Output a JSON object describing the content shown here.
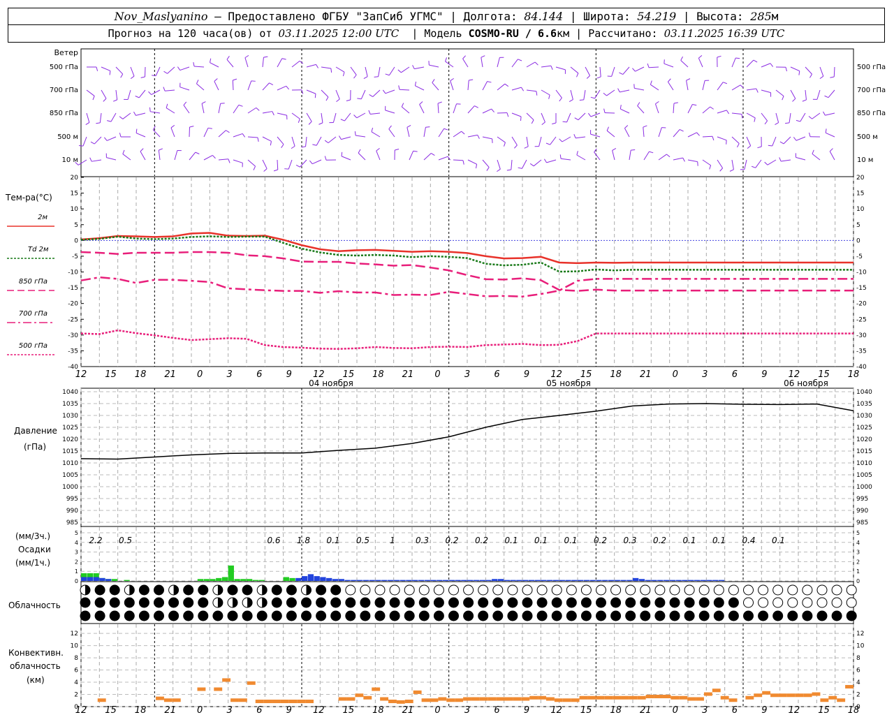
{
  "header": {
    "station": "Nov_Maslyanino",
    "provider": "— Предоставлено ФГБУ \"ЗапСиб УГМС\"",
    "lon_label": "| Долгота:",
    "lon": "84.144",
    "lat_label": "| Широта:",
    "lat": "54.219",
    "alt_label": "| Высота:",
    "alt": "285",
    "alt_unit": "м",
    "forecast_label": "Прогноз на 120 часа(ов) от",
    "forecast_from": "03.11.2025 12:00 UTC",
    "model_label": "| Модель",
    "model": "COSMO-RU / 6.6",
    "model_unit": "км",
    "calc_label": "| Рассчитано:",
    "calc_time": "03.11.2025 16:39 UTC"
  },
  "time_axis": {
    "hour_ticks": [
      "12",
      "15",
      "18",
      "21",
      "0",
      "3",
      "6",
      "9",
      "12",
      "15",
      "18",
      "21",
      "0",
      "3",
      "6",
      "9",
      "12",
      "15",
      "18",
      "21",
      "0",
      "3",
      "6",
      "9",
      "12",
      "15",
      "18"
    ],
    "dates": [
      "04 ноября",
      "05 ноября",
      "06 ноября"
    ]
  },
  "colors": {
    "wind": "#8a2be2",
    "t2m": "#e8322a",
    "td2m": "#1a7a1a",
    "t850": "#e81e7a",
    "t700": "#e81e7a",
    "t500": "#e81e7a",
    "pressure": "#000000",
    "precip_rain": "#22cc22",
    "precip_snow": "#2244dd",
    "conv": "#f08a30",
    "zero_line": "#4040e0"
  },
  "wind_panel": {
    "title": "Ветер",
    "levels": [
      "500 гПа",
      "700 гПа",
      "850 гПа",
      "500 м",
      "10 м"
    ]
  },
  "temp_panel": {
    "title": "Тем-ра(°C)",
    "legend": [
      "2м",
      "Td 2м",
      "850 гПа",
      "700 гПа",
      "500 гПа"
    ],
    "ticks": [
      "20",
      "15",
      "10",
      "5",
      "0",
      "-5",
      "-10",
      "-15",
      "-20",
      "-25",
      "-30",
      "-35",
      "-40"
    ]
  },
  "pressure_panel": {
    "title1": "Давление",
    "title2": "(гПа)",
    "ticks": [
      "1040",
      "1035",
      "1030",
      "1025",
      "1020",
      "1015",
      "1010",
      "1005",
      "1000",
      "995",
      "990",
      "985"
    ]
  },
  "precip_panel": {
    "unit3": "(мм/3ч.)",
    "title": "Осадки",
    "unit1": "(мм/1ч.)",
    "ticks": [
      "5",
      "4",
      "3",
      "2",
      "1",
      "0"
    ],
    "labels3h": [
      "2.2",
      "0.5",
      "",
      "",
      "",
      "",
      "0.6",
      "1.8",
      "0.1",
      "0.5",
      "1",
      "0.3",
      "0.2",
      "0.2",
      "0.1",
      "0.1",
      "0.1",
      "0.2",
      "0.3",
      "0.2",
      "0.1",
      "0.1",
      "0.4",
      "0.1",
      "",
      ""
    ]
  },
  "cloud_panel": {
    "title": "Облачность"
  },
  "conv_panel": {
    "title1": "Конвективн.",
    "title2": "облачность",
    "title3": "(км)",
    "ticks": [
      "12",
      "10",
      "8",
      "6",
      "4",
      "2",
      "0"
    ]
  },
  "chart_data": [
    {
      "type": "line",
      "title": "Тем-ра(°C)",
      "x_hours_from_start": [
        0,
        3,
        6,
        9,
        12,
        15,
        18,
        21,
        24,
        27,
        30,
        33,
        36,
        39,
        42,
        45,
        48,
        51,
        54,
        57,
        60,
        63,
        66,
        69,
        72,
        75,
        78,
        81,
        84,
        87,
        90,
        93,
        96,
        99,
        102,
        105,
        108,
        111,
        114,
        117,
        120,
        123,
        126,
        129,
        132,
        135,
        138,
        141,
        144,
        147,
        150
      ],
      "ylim": [
        -40,
        20
      ],
      "series": [
        {
          "name": "2м",
          "values": [
            0.3,
            0.7,
            1.4,
            1.3,
            1.1,
            1.3,
            2.2,
            2.4,
            1.5,
            1.4,
            1.5,
            0.2,
            -1.5,
            -2.8,
            -3.4,
            -3.1,
            -3.0,
            -3.3,
            -3.6,
            -3.4,
            -3.6,
            -4.0,
            -5.0,
            -5.7,
            -5.6,
            -5.2,
            -7.0,
            -7.2,
            -7.0,
            -7.1,
            -7.0,
            -7.0,
            -7.0,
            -7.0,
            -7.0,
            -7.0,
            -7.0,
            -7.0,
            -7.0,
            -7.0,
            -7.0,
            -7.0,
            -7.0,
            -7.0,
            -7.0,
            -7.0,
            -7.0,
            -7.0,
            -7.0,
            -7.0,
            -7.0
          ]
        },
        {
          "name": "Td 2м",
          "values": [
            0.2,
            0.5,
            1.2,
            0.6,
            0.4,
            0.6,
            1.1,
            1.3,
            1.1,
            1.2,
            1.2,
            -0.8,
            -2.6,
            -3.8,
            -4.6,
            -4.8,
            -4.6,
            -4.8,
            -5.3,
            -5.0,
            -5.2,
            -5.6,
            -7.4,
            -7.9,
            -7.7,
            -7.0,
            -9.9,
            -9.8,
            -9.2,
            -9.5,
            -9.3,
            -9.3,
            -9.3,
            -9.3,
            -9.3,
            -9.3,
            -9.3,
            -9.3,
            -9.3,
            -9.3,
            -9.3,
            -9.3,
            -9.3,
            -9.3,
            -9.3,
            -9.3,
            -9.3,
            -9.3,
            -9.3,
            -9.3,
            -9.3
          ]
        },
        {
          "name": "850 гПа",
          "values": [
            -3.7,
            -3.9,
            -4.3,
            -3.9,
            -3.9,
            -3.9,
            -3.7,
            -3.7,
            -3.9,
            -4.7,
            -5.0,
            -5.7,
            -6.7,
            -6.8,
            -6.8,
            -7.3,
            -7.6,
            -8.0,
            -7.8,
            -8.6,
            -9.5,
            -11.0,
            -12.3,
            -12.4,
            -12.0,
            -12.6,
            -15.7,
            -16.0,
            -15.6,
            -15.9,
            -15.9,
            -15.9,
            -15.9,
            -15.9,
            -15.9,
            -15.9,
            -15.9,
            -15.9,
            -15.9,
            -15.9,
            -15.9,
            -15.9,
            -15.9,
            -15.9,
            -15.9,
            -15.9,
            -15.9,
            -15.9,
            -15.9,
            -15.9,
            -15.9
          ]
        },
        {
          "name": "700 гПа",
          "values": [
            -12.7,
            -11.7,
            -12.2,
            -13.5,
            -12.5,
            -12.5,
            -12.8,
            -13.2,
            -15.2,
            -15.5,
            -15.8,
            -16.0,
            -16.0,
            -16.6,
            -16.1,
            -16.5,
            -16.5,
            -17.3,
            -17.2,
            -17.3,
            -16.3,
            -17.0,
            -17.7,
            -17.6,
            -17.8,
            -17.0,
            -15.9,
            -12.8,
            -12.2,
            -12.2,
            -12.2,
            -12.2,
            -12.2,
            -12.2,
            -12.2,
            -12.2,
            -12.2,
            -12.2,
            -12.2,
            -12.2,
            -12.2,
            -12.2,
            -12.2,
            -12.2,
            -12.2,
            -12.2,
            -12.2,
            -12.2,
            -12.2,
            -12.2,
            -12.2
          ]
        },
        {
          "name": "500 гПа",
          "values": [
            -29.5,
            -29.7,
            -28.5,
            -29.4,
            -30.1,
            -30.9,
            -31.6,
            -31.3,
            -31.0,
            -31.2,
            -33.2,
            -33.8,
            -34.0,
            -34.3,
            -34.4,
            -34.2,
            -33.8,
            -34.1,
            -34.2,
            -33.8,
            -33.7,
            -33.8,
            -33.2,
            -33.0,
            -32.8,
            -33.2,
            -33.1,
            -31.9,
            -29.5,
            -29.5,
            -29.5,
            -29.5,
            -29.5,
            -29.5,
            -29.5,
            -29.5,
            -29.5,
            -29.5,
            -29.5,
            -29.5,
            -29.5,
            -29.5,
            -29.5,
            -29.5,
            -29.5,
            -29.5,
            -29.5,
            -29.5,
            -29.5,
            -29.5,
            -29.5
          ]
        }
      ]
    },
    {
      "type": "line",
      "title": "Давление (гПа)",
      "x_hours_from_start": [
        0,
        6,
        12,
        18,
        24,
        30,
        36,
        42,
        48,
        54,
        60,
        66,
        72,
        78,
        84,
        90,
        96,
        102,
        108,
        114,
        120,
        126
      ],
      "ylim": [
        985,
        1040
      ],
      "series": [
        {
          "name": "Давление",
          "values": [
            1011.8,
            1011.6,
            1012.5,
            1013.4,
            1014.0,
            1014.2,
            1014.2,
            1015.3,
            1016.2,
            1018.2,
            1021.0,
            1025.0,
            1028.3,
            1030.0,
            1031.8,
            1034.0,
            1034.8,
            1035.0,
            1034.7,
            1034.6,
            1034.8,
            1032.0
          ]
        }
      ]
    },
    {
      "type": "bar",
      "title": "Осадки",
      "ylim": [
        0,
        5
      ],
      "series": [
        {
          "name": "rain",
          "values": [
            0.8,
            0.8,
            0.8,
            0.3,
            0.2,
            0.2,
            0.0,
            0.1,
            0.0,
            0.0,
            0.0,
            0.0,
            0.0,
            0.0,
            0.0,
            0.0,
            0.0,
            0.0,
            0.0,
            0.2,
            0.2,
            0.2,
            0.3,
            0.4,
            1.6,
            0.2,
            0.2,
            0.2,
            0.1,
            0.1,
            0.0,
            0.0,
            0.0,
            0.4,
            0.3
          ]
        },
        {
          "name": "snow",
          "values": [
            0.4,
            0.4,
            0.4,
            0.3,
            0.2,
            0.0,
            0.0,
            0.0,
            0.0,
            0.0,
            0.0,
            0.0,
            0.0,
            0.0,
            0.0,
            0.0,
            0.0,
            0.0,
            0.0,
            0.0,
            0.0,
            0.0,
            0.0,
            0.0,
            0.0,
            0.0,
            0.0,
            0.0,
            0.0,
            0.0,
            0.0,
            0.0,
            0.0,
            0.0,
            0.0,
            0.3,
            0.5,
            0.7,
            0.5,
            0.4,
            0.3,
            0.2,
            0.2,
            0.1,
            0.1,
            0.1,
            0.1,
            0.1,
            0.1,
            0.1,
            0.1,
            0.1,
            0.1,
            0.1,
            0.1,
            0.1,
            0.1,
            0.1,
            0.1,
            0.1,
            0.1,
            0.1,
            0.1,
            0.1,
            0.1,
            0.1,
            0.1,
            0.2,
            0.2,
            0.1,
            0.1,
            0.1,
            0.1,
            0.1,
            0.1,
            0.1,
            0.1,
            0.1,
            0.1,
            0.1,
            0.1,
            0.1,
            0.1,
            0.1,
            0.1,
            0.1,
            0.1,
            0.1,
            0.1,
            0.1,
            0.3,
            0.2,
            0.1,
            0.1,
            0.1,
            0.1,
            0.1,
            0.1,
            0.1,
            0.1,
            0.1,
            0.1,
            0.1,
            0.1,
            0.1
          ]
        }
      ]
    },
    {
      "type": "bar",
      "title": "Конвективн. облачность (км)",
      "ylim": [
        0,
        13
      ],
      "series": [
        {
          "name": "conv",
          "values": [
            0.0,
            0.0,
            1.0,
            0.0,
            0.0,
            0.0,
            0.0,
            0.0,
            0.0,
            1.3,
            1.0,
            1.0,
            0.0,
            0.0,
            2.8,
            0.0,
            2.8,
            4.3,
            1.0,
            1.0,
            3.8,
            0.8,
            0.8,
            0.8,
            0.8,
            0.8,
            0.8,
            0.8,
            0.0,
            0.0,
            0.0,
            1.2,
            1.2,
            1.8,
            1.4,
            2.8,
            1.2,
            0.8,
            0.7,
            0.8,
            2.3,
            1.0,
            1.0,
            1.2,
            1.0,
            1.0,
            1.2,
            1.2,
            1.2,
            1.2,
            1.2,
            1.2,
            1.2,
            1.2,
            1.4,
            1.4,
            1.2,
            1.0,
            1.0,
            1.0,
            1.4,
            1.4,
            1.4,
            1.4,
            1.4,
            1.4,
            1.4,
            1.4,
            1.6,
            1.6,
            1.6,
            1.4,
            1.4,
            1.2,
            1.2,
            2.0,
            2.6,
            1.4,
            1.0,
            0.0,
            1.4,
            1.8,
            2.2,
            1.8,
            1.8,
            1.8,
            1.8,
            1.8,
            2.0,
            1.0,
            1.4,
            1.0,
            3.2
          ]
        }
      ]
    }
  ]
}
